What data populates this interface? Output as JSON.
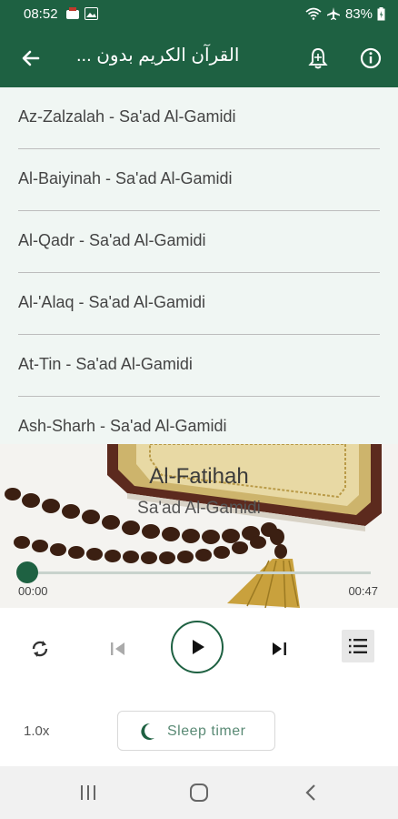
{
  "status_bar": {
    "time": "08:52",
    "battery": "83%"
  },
  "app_bar": {
    "title": "القرآن الكريم بدون ..."
  },
  "playlist": [
    {
      "label": "Az-Zalzalah - Sa'ad Al-Gamidi"
    },
    {
      "label": "Al-Baiyinah - Sa'ad Al-Gamidi"
    },
    {
      "label": "Al-Qadr - Sa'ad Al-Gamidi"
    },
    {
      "label": "Al-'Alaq - Sa'ad Al-Gamidi"
    },
    {
      "label": "At-Tin - Sa'ad Al-Gamidi"
    },
    {
      "label": "Ash-Sharh - Sa'ad Al-Gamidi"
    }
  ],
  "now_playing": {
    "title": "Al-Fatihah",
    "artist": "Sa'ad Al-Gamidi",
    "current_time": "00:00",
    "duration": "00:47",
    "progress": 0
  },
  "footer": {
    "speed": "1.0x",
    "sleep_timer_label": "Sleep timer"
  },
  "colors": {
    "primary": "#1e6142",
    "list_background": "#f0f6f3"
  },
  "icons": [
    "arrow-back-icon",
    "bell-icon",
    "info-icon",
    "repeat-icon",
    "skip-previous-icon",
    "play-icon",
    "skip-next-icon",
    "playlist-icon",
    "moon-icon"
  ]
}
